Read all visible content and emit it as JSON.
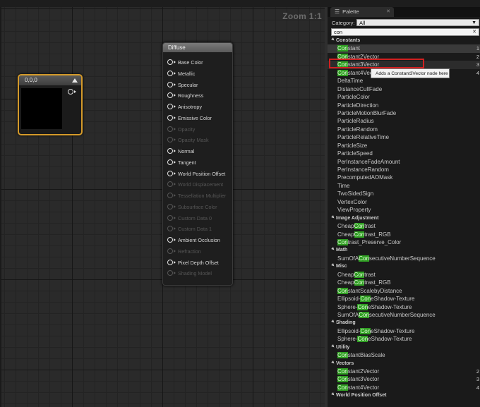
{
  "graph": {
    "zoom_label": "Zoom 1:1",
    "constant_node": {
      "title": "0,0,0"
    },
    "material_node": {
      "title": "Diffuse",
      "pins": [
        {
          "label": "Base Color",
          "enabled": true
        },
        {
          "label": "Metallic",
          "enabled": true
        },
        {
          "label": "Specular",
          "enabled": true
        },
        {
          "label": "Roughness",
          "enabled": true
        },
        {
          "label": "Anisotropy",
          "enabled": true
        },
        {
          "label": "Emissive Color",
          "enabled": true
        },
        {
          "label": "Opacity",
          "enabled": false
        },
        {
          "label": "Opacity Mask",
          "enabled": false
        },
        {
          "label": "Normal",
          "enabled": true
        },
        {
          "label": "Tangent",
          "enabled": true
        },
        {
          "label": "World Position Offset",
          "enabled": true
        },
        {
          "label": "World Displacement",
          "enabled": false
        },
        {
          "label": "Tessellation Multiplier",
          "enabled": false
        },
        {
          "label": "Subsurface Color",
          "enabled": false
        },
        {
          "label": "Custom Data 0",
          "enabled": false
        },
        {
          "label": "Custom Data 1",
          "enabled": false
        },
        {
          "label": "Ambient Occlusion",
          "enabled": true
        },
        {
          "label": "Refraction",
          "enabled": false
        },
        {
          "label": "Pixel Depth Offset",
          "enabled": true
        },
        {
          "label": "Shading Model",
          "enabled": false
        }
      ]
    }
  },
  "palette": {
    "tab_label": "Palette",
    "category_label": "Category:",
    "category_value": "All",
    "search_value": "con",
    "tooltip": "Adds a Constant3Vector node here",
    "rows": [
      {
        "type": "cat",
        "label": "Constants"
      },
      {
        "type": "item",
        "pre": "",
        "hl": "Con",
        "post": "stant",
        "num": "1",
        "state": "sel"
      },
      {
        "type": "item",
        "pre": "",
        "hl": "Con",
        "post": "stant2Vector",
        "num": "2"
      },
      {
        "type": "item",
        "pre": "",
        "hl": "Con",
        "post": "stant3Vector",
        "num": "3",
        "state": "hov"
      },
      {
        "type": "item",
        "pre": "",
        "hl": "Con",
        "post": "stant4Vector",
        "num": "4"
      },
      {
        "type": "item",
        "pre": "DeltaTime",
        "hl": "",
        "post": ""
      },
      {
        "type": "item",
        "pre": "DistanceCullFade",
        "hl": "",
        "post": ""
      },
      {
        "type": "item",
        "pre": "ParticleColor",
        "hl": "",
        "post": ""
      },
      {
        "type": "item",
        "pre": "ParticleDirection",
        "hl": "",
        "post": ""
      },
      {
        "type": "item",
        "pre": "ParticleMotionBlurFade",
        "hl": "",
        "post": ""
      },
      {
        "type": "item",
        "pre": "ParticleRadius",
        "hl": "",
        "post": ""
      },
      {
        "type": "item",
        "pre": "ParticleRandom",
        "hl": "",
        "post": ""
      },
      {
        "type": "item",
        "pre": "ParticleRelativeTime",
        "hl": "",
        "post": ""
      },
      {
        "type": "item",
        "pre": "ParticleSize",
        "hl": "",
        "post": ""
      },
      {
        "type": "item",
        "pre": "ParticleSpeed",
        "hl": "",
        "post": ""
      },
      {
        "type": "item",
        "pre": "PerInstanceFadeAmount",
        "hl": "",
        "post": ""
      },
      {
        "type": "item",
        "pre": "PerInstanceRandom",
        "hl": "",
        "post": ""
      },
      {
        "type": "item",
        "pre": "PrecomputedAOMask",
        "hl": "",
        "post": ""
      },
      {
        "type": "item",
        "pre": "Time",
        "hl": "",
        "post": ""
      },
      {
        "type": "item",
        "pre": "TwoSidedSign",
        "hl": "",
        "post": ""
      },
      {
        "type": "item",
        "pre": "VertexColor",
        "hl": "",
        "post": ""
      },
      {
        "type": "item",
        "pre": "ViewProperty",
        "hl": "",
        "post": ""
      },
      {
        "type": "cat",
        "label": "Image Adjustment"
      },
      {
        "type": "item",
        "pre": "Cheap",
        "hl": "Con",
        "post": "trast"
      },
      {
        "type": "item",
        "pre": "Cheap",
        "hl": "Con",
        "post": "trast_RGB"
      },
      {
        "type": "item",
        "pre": "",
        "hl": "Con",
        "post": "trast_Preserve_Color"
      },
      {
        "type": "cat",
        "label": "Math"
      },
      {
        "type": "item",
        "pre": "SumOfA",
        "hl": "Con",
        "post": "secutiveNumberSequence"
      },
      {
        "type": "cat",
        "label": "Misc"
      },
      {
        "type": "item",
        "pre": "Cheap",
        "hl": "Con",
        "post": "trast"
      },
      {
        "type": "item",
        "pre": "Cheap",
        "hl": "Con",
        "post": "trast_RGB"
      },
      {
        "type": "item",
        "pre": "",
        "hl": "Con",
        "post": "stantScalebyDistance"
      },
      {
        "type": "item",
        "pre": "Ellipsoid-",
        "hl": "Con",
        "post": "eShadow-Texture"
      },
      {
        "type": "item",
        "pre": "Sphere-",
        "hl": "Con",
        "post": "eShadow-Texture"
      },
      {
        "type": "item",
        "pre": "SumOfA",
        "hl": "Con",
        "post": "secutiveNumberSequence"
      },
      {
        "type": "cat",
        "label": "Shading"
      },
      {
        "type": "item",
        "pre": "Ellipsoid-",
        "hl": "Con",
        "post": "eShadow-Texture"
      },
      {
        "type": "item",
        "pre": "Sphere-",
        "hl": "Con",
        "post": "eShadow-Texture"
      },
      {
        "type": "cat",
        "label": "Utility"
      },
      {
        "type": "item",
        "pre": "",
        "hl": "Con",
        "post": "stantBiasScale"
      },
      {
        "type": "cat",
        "label": "Vectors"
      },
      {
        "type": "item",
        "pre": "",
        "hl": "Con",
        "post": "stant2Vector",
        "num": "2"
      },
      {
        "type": "item",
        "pre": "",
        "hl": "Con",
        "post": "stant3Vector",
        "num": "3"
      },
      {
        "type": "item",
        "pre": "",
        "hl": "Con",
        "post": "stant4Vector",
        "num": "4"
      },
      {
        "type": "cat",
        "label": "World Position Offset"
      }
    ]
  }
}
